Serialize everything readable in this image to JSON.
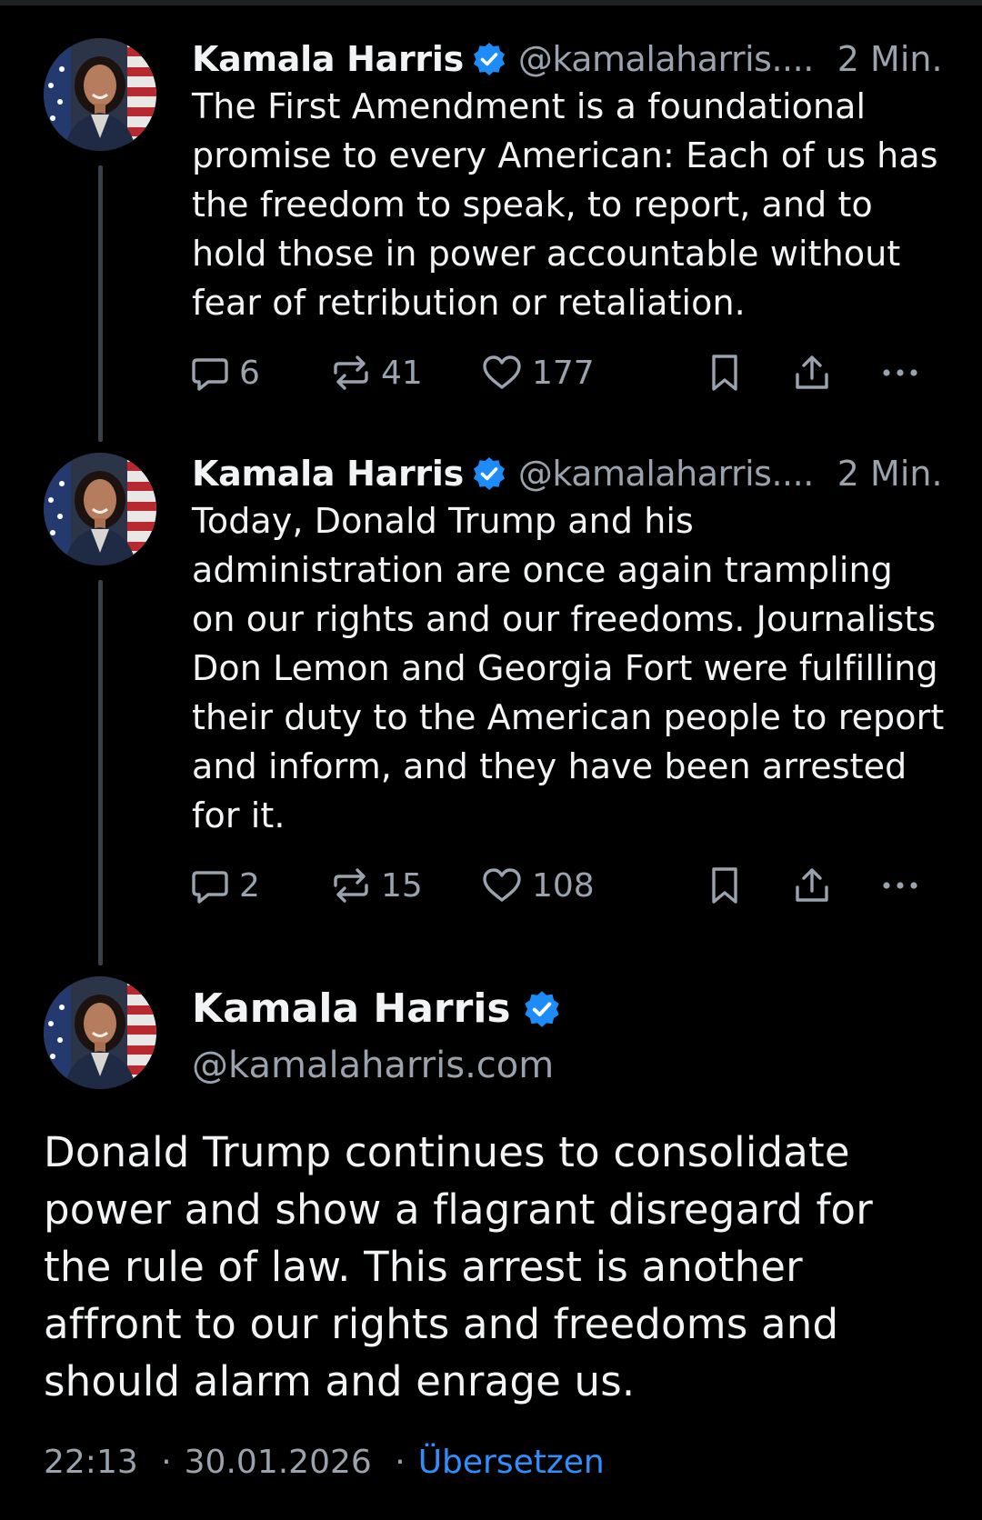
{
  "colors": {
    "background": "#000000",
    "text": "#f1f3f5",
    "muted": "#9aa3ad",
    "accent": "#2f8fff",
    "verified": "#1d8cf8",
    "thread_line": "#3b4148"
  },
  "thread": [
    {
      "author": "Kamala Harris",
      "handle": "@kamalaharris....",
      "time": "2 Min.",
      "text": "The First Amendment is a foundational promise to every American: Each of us has the freedom to speak, to report, and to hold those in power accountable without fear of retribution or retaliation.",
      "replies": "6",
      "reposts": "41",
      "likes": "177"
    },
    {
      "author": "Kamala Harris",
      "handle": "@kamalaharris....",
      "time": "2 Min.",
      "text": "Today, Donald Trump and his administration are once again trampling on our rights and our freedoms. Journalists Don Lemon and Georgia Fort were fulfilling their duty to the American people to report and inform, and they have been arrested for it.",
      "replies": "2",
      "reposts": "15",
      "likes": "108"
    }
  ],
  "main_post": {
    "author": "Kamala Harris",
    "handle": "@kamalaharris.com",
    "text": "Donald Trump continues to consolidate power and show a flagrant disregard for the rule of law. This arrest is another affront to our rights and freedoms and should alarm and enrage us.",
    "time": "22:13",
    "date": "30.01.2026",
    "separator": "·",
    "translate_label": "Übersetzen"
  },
  "icons": {
    "reply": "speech-bubble-icon",
    "repost": "repost-arrows-icon",
    "like": "heart-icon",
    "bookmark": "bookmark-icon",
    "share": "share-upload-icon",
    "more": "more-dots-icon",
    "verified": "verified-check-icon"
  }
}
